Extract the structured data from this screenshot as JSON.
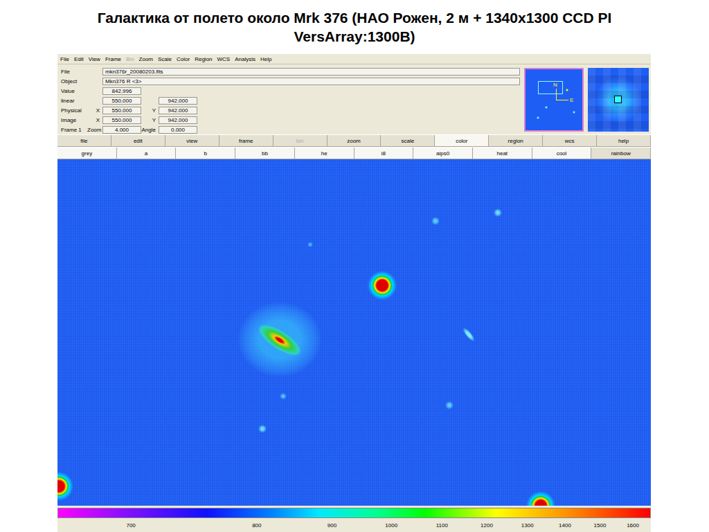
{
  "slide": {
    "title": "Галактика от полето около Mrk 376 (НАО Рожен, 2 м + 1340x1300 CCD PI VersArray:1300B)"
  },
  "menu": [
    {
      "label": "File",
      "disabled": false
    },
    {
      "label": "Edit",
      "disabled": false
    },
    {
      "label": "View",
      "disabled": false
    },
    {
      "label": "Frame",
      "disabled": false
    },
    {
      "label": "Bin",
      "disabled": true
    },
    {
      "label": "Zoom",
      "disabled": false
    },
    {
      "label": "Scale",
      "disabled": false
    },
    {
      "label": "Color",
      "disabled": false
    },
    {
      "label": "Region",
      "disabled": false
    },
    {
      "label": "WCS",
      "disabled": false
    },
    {
      "label": "Analysis",
      "disabled": false
    },
    {
      "label": "Help",
      "disabled": false
    }
  ],
  "info": [
    {
      "label": "File",
      "kind": "wide",
      "fields": [
        {
          "value": "mkn376r_20080203.fits"
        }
      ]
    },
    {
      "label": "Object",
      "kind": "wide",
      "fields": [
        {
          "value": "Mkn376 R <3>"
        }
      ]
    },
    {
      "label": "Value",
      "kind": "short",
      "fields": [
        {
          "value": "842.996"
        }
      ]
    },
    {
      "label": "linear",
      "kind": "short",
      "fields": [
        {
          "value": "550.000"
        },
        {
          "value": "942.000"
        }
      ]
    },
    {
      "label": "Physical",
      "kind": "short",
      "fields": [
        {
          "prefix": "X",
          "value": "550.000"
        },
        {
          "prefix": "Y",
          "value": "942.000"
        }
      ]
    },
    {
      "label": "Image",
      "kind": "short",
      "fields": [
        {
          "prefix": "X",
          "value": "550.000"
        },
        {
          "prefix": "Y",
          "value": "942.000"
        }
      ]
    },
    {
      "label": "Frame 1",
      "kind": "short",
      "fields": [
        {
          "prefix": "Zoom",
          "value": "4.000"
        },
        {
          "prefix": "Angle",
          "value": "0.000"
        }
      ]
    }
  ],
  "panner": {
    "compass": [
      "N",
      "E"
    ]
  },
  "buttonbar": [
    {
      "label": "file",
      "selected": false,
      "disabled": false
    },
    {
      "label": "edit",
      "selected": false,
      "disabled": false
    },
    {
      "label": "view",
      "selected": false,
      "disabled": false
    },
    {
      "label": "frame",
      "selected": false,
      "disabled": false
    },
    {
      "label": "bin",
      "selected": false,
      "disabled": true
    },
    {
      "label": "zoom",
      "selected": false,
      "disabled": false
    },
    {
      "label": "scale",
      "selected": false,
      "disabled": false
    },
    {
      "label": "color",
      "selected": true,
      "disabled": false
    },
    {
      "label": "region",
      "selected": false,
      "disabled": false
    },
    {
      "label": "wcs",
      "selected": false,
      "disabled": false
    },
    {
      "label": "help",
      "selected": false,
      "disabled": false
    }
  ],
  "colormaps": [
    {
      "label": "grey",
      "selected": false
    },
    {
      "label": "a",
      "selected": false
    },
    {
      "label": "b",
      "selected": false
    },
    {
      "label": "bb",
      "selected": false
    },
    {
      "label": "he",
      "selected": false
    },
    {
      "label": "i8",
      "selected": false
    },
    {
      "label": "aips0",
      "selected": false
    },
    {
      "label": "heat",
      "selected": false
    },
    {
      "label": "cool",
      "selected": false
    },
    {
      "label": "rainbow",
      "selected": true
    }
  ],
  "colorbar": {
    "ticks": [
      "700",
      "800",
      "900",
      "1000",
      "1100",
      "1200",
      "1300",
      "1400",
      "1500",
      "1600"
    ]
  }
}
